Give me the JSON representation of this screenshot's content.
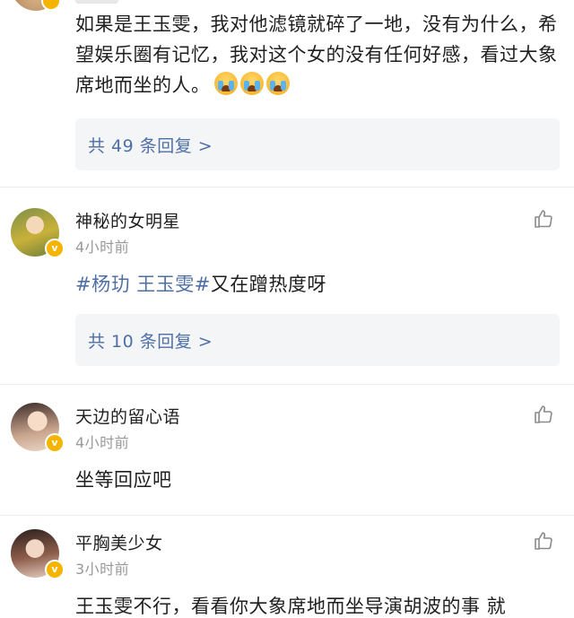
{
  "comments": [
    {
      "text": "如果是王玉雯，我对他滤镜就碎了一地，没有为什么，希望娱乐圈有记忆，我对这个女的没有任何好感，看过大象席地而坐的人。",
      "reply_summary": "共 49 条回复 >"
    },
    {
      "username": "神秘的女明星",
      "time": "4小时前",
      "text_tag": "#杨玏 王玉雯#",
      "text": "又在蹭热度呀",
      "reply_summary": "共 10 条回复 >"
    },
    {
      "username": "天边的留心语",
      "time": "4小时前",
      "text": "坐等回应吧"
    },
    {
      "username": "平胸美少女",
      "time": "3小时前",
      "text": "王玉雯不行，看看你大象席地而坐导演胡波的事 就"
    }
  ],
  "badge_glyph": "v",
  "colors": {
    "link": "#4e6fa6",
    "badge": "#f5b400",
    "meta": "#999999"
  },
  "icons": {
    "like": "thumbs-up-icon",
    "emoji": "crying-face-emoji"
  }
}
